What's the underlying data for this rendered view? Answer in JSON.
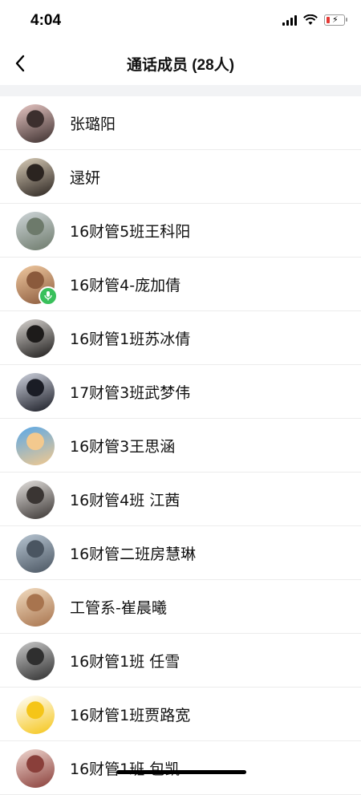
{
  "status_bar": {
    "time": "4:04"
  },
  "nav": {
    "title": "通话成员 (28人)"
  },
  "members": [
    {
      "name": "张璐阳",
      "colors": [
        "#e8c7c4",
        "#3c2f2e"
      ]
    },
    {
      "name": "逯妍",
      "colors": [
        "#d9cdb8",
        "#2b2420"
      ]
    },
    {
      "name": "16财管5班王科阳",
      "colors": [
        "#cfd6d9",
        "#6d7a6b"
      ]
    },
    {
      "name": "16财管4-庞加倩",
      "colors": [
        "#f0c9a0",
        "#8b5a3c"
      ],
      "speaking": true
    },
    {
      "name": "16财管1班苏冰倩",
      "colors": [
        "#d8d4d0",
        "#1d1b1a"
      ]
    },
    {
      "name": "17财管3班武梦伟",
      "colors": [
        "#cfd3df",
        "#1a1c25"
      ]
    },
    {
      "name": "16财管3王思涵",
      "colors": [
        "#5aa8e8",
        "#f3c98e"
      ]
    },
    {
      "name": "16财管4班  江茜",
      "colors": [
        "#e4e1de",
        "#3a3533"
      ]
    },
    {
      "name": "16财管二班房慧琳",
      "colors": [
        "#b8c6d3",
        "#4a5561"
      ]
    },
    {
      "name": "工管系-崔晨曦",
      "colors": [
        "#f2dcc0",
        "#a8744e"
      ]
    },
    {
      "name": "16财管1班 任雪",
      "colors": [
        "#c9c9c9",
        "#2f2f2f"
      ]
    },
    {
      "name": "16财管1班贾路宽",
      "colors": [
        "#ffffff",
        "#f5c518"
      ]
    },
    {
      "name": "16财管1班  包凯...",
      "colors": [
        "#f0d7d0",
        "#8a3f3a"
      ]
    }
  ]
}
